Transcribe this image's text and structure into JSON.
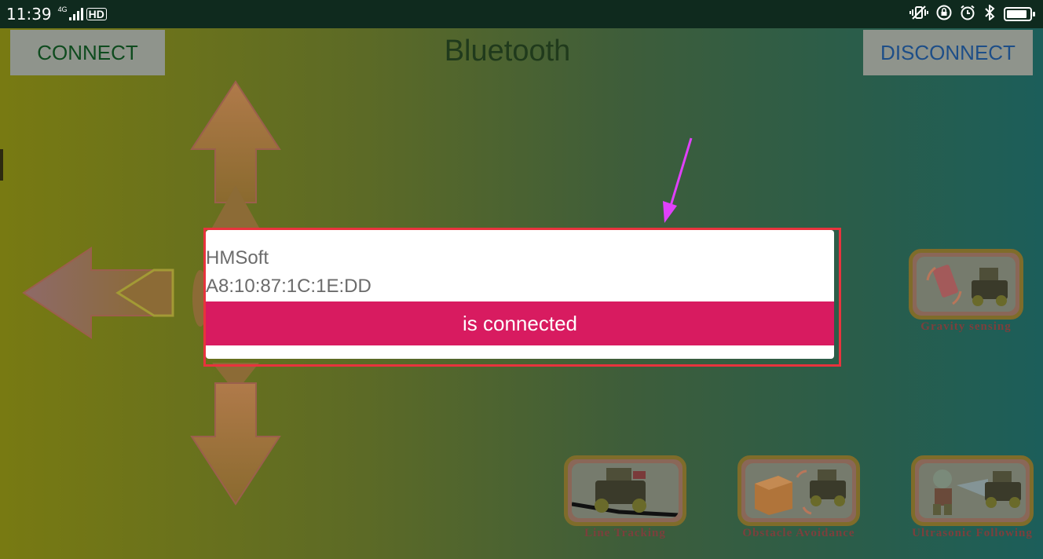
{
  "status_bar": {
    "time": "11:39",
    "network": "4G",
    "hd": "HD",
    "icons": [
      "vibrate-icon",
      "rotation-lock-icon",
      "alarm-icon",
      "bluetooth-icon",
      "battery-icon"
    ],
    "battery_level": 0.9
  },
  "app": {
    "title": "Bluetooth",
    "connect_label": "CONNECT",
    "disconnect_label": "DISCONNECT",
    "direction_pad": [
      "up-arrow-icon",
      "left-arrow-icon",
      "down-arrow-icon"
    ],
    "modes": [
      {
        "name": "Gravity sensing",
        "icon": "phone-rotate-car-icon"
      },
      {
        "name": "Line Tracking",
        "icon": "car-on-line-icon"
      },
      {
        "name": "Obstacle Avoidance",
        "icon": "box-and-car-icon"
      },
      {
        "name": "Ultrasonic Following",
        "icon": "zombie-and-car-icon"
      }
    ]
  },
  "dialog": {
    "device_name": "HMSoft",
    "device_address": "A8:10:87:1C:1E:DD",
    "toast": "is connected"
  },
  "colors": {
    "toast": "#d81b60",
    "highlight_border": "#e8333d",
    "pointer_arrow": "#e040fb"
  }
}
